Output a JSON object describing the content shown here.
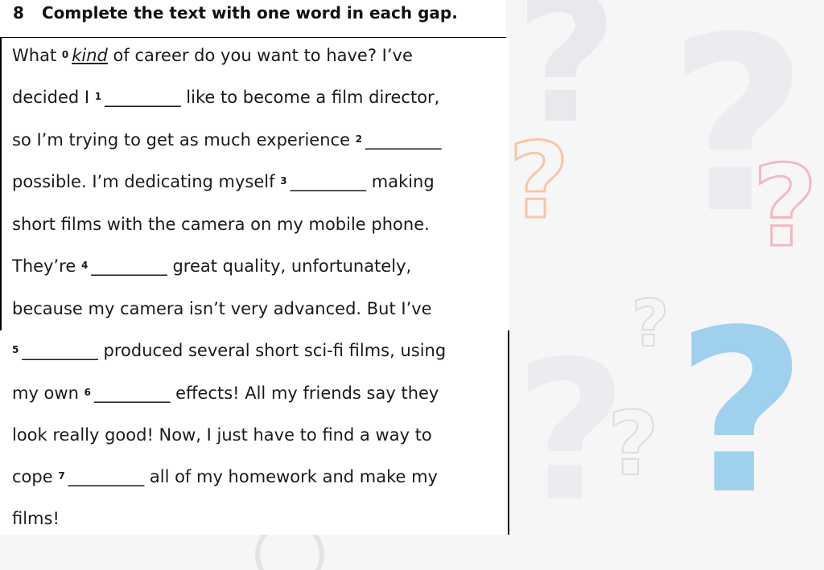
{
  "exercise": {
    "number": "8",
    "title": "Complete the text with one word in each gap."
  },
  "gap_blank": "_________",
  "lines": [
    {
      "t1": "What ",
      "sup": "0",
      "example": "kind",
      "t2": " of career do you want to have? I’ve"
    },
    {
      "t1": "decided I ",
      "sup": "1",
      "t2": " like to become a film director,"
    },
    {
      "t1": "so I’m trying to get as much experience ",
      "sup": "2",
      "t2": ""
    },
    {
      "t1": "possible. I’m dedicating myself ",
      "sup": "3",
      "t2": " making"
    },
    {
      "t1": "short films with the camera on my mobile phone.",
      "sup": "",
      "t2": ""
    },
    {
      "t1": "They’re ",
      "sup": "4",
      "t2": " great quality, unfortunately,"
    },
    {
      "t1": "because my camera isn’t very advanced. But I’ve",
      "sup": "",
      "t2": ""
    },
    {
      "t1": "",
      "sup": "5",
      "t2": " produced several short sci-fi films, using"
    },
    {
      "t1": "my own ",
      "sup": "6",
      "t2": " effects! All my friends say they"
    },
    {
      "t1": "look really good! Now, I just have to find a way to",
      "sup": "",
      "t2": ""
    },
    {
      "t1": "cope ",
      "sup": "7",
      "t2": " all of my homework and make my"
    },
    {
      "t1": "films!",
      "sup": "",
      "t2": ""
    }
  ],
  "colors": {
    "accent_blue": "#9fd0ee",
    "accent_orange": "#f6c6a6",
    "accent_pink": "#f3b8c0",
    "decor_grey": "#e6e6ea"
  },
  "decorations": [
    "question-mark-icon",
    "question-mark-icon",
    "question-mark-icon",
    "question-mark-icon",
    "question-mark-icon"
  ]
}
